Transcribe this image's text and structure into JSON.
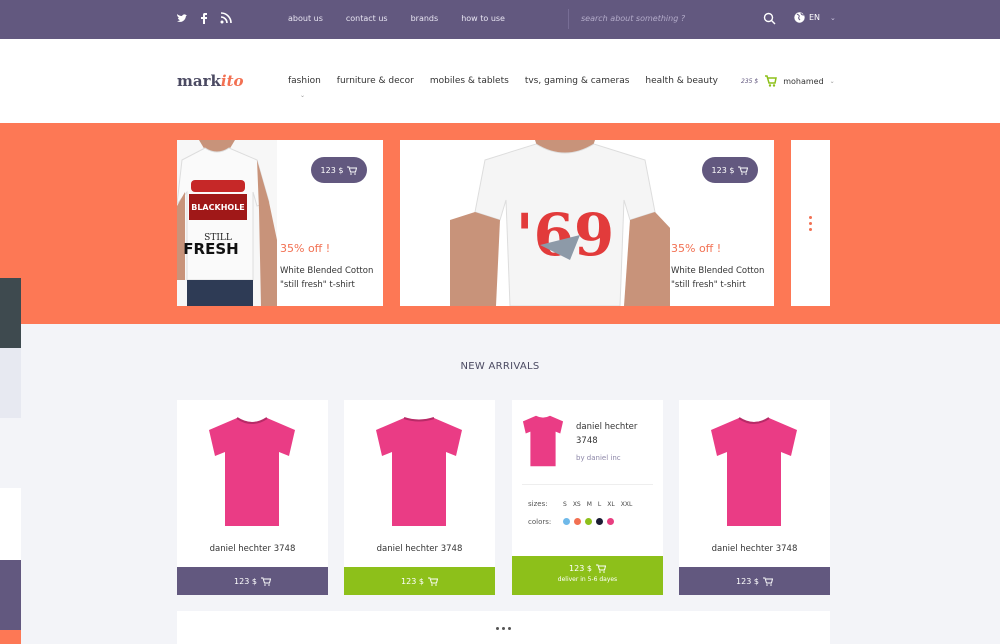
{
  "topbar": {
    "nav": [
      "about us",
      "contact us",
      "brands",
      "how to use"
    ],
    "search_placeholder": "search about something ?",
    "lang": "EN"
  },
  "header": {
    "logo_main": "mark",
    "logo_accent": "ito",
    "nav": [
      "fashion",
      "furniture & decor",
      "mobiles & tablets",
      "tvs, gaming & cameras",
      "health & beauty"
    ],
    "cart_total": "235 $",
    "user": "mohamed"
  },
  "hero": {
    "slides": [
      {
        "price": "123 $",
        "discount": "35% off !",
        "title_line1": "White Blended Cotton",
        "title_line2": "\"still fresh\" t-shirt"
      },
      {
        "price": "123 $",
        "discount": "35% off !",
        "title_line1": "White Blended Cotton",
        "title_line2": "\"still fresh\" t-shirt"
      }
    ]
  },
  "new_arrivals": {
    "title": "NEW ARRIVALS",
    "products": [
      {
        "name": "daniel hechter 3748",
        "price": "123 $"
      },
      {
        "name": "daniel hechter 3748",
        "price": "123 $"
      },
      {
        "name_line1": "daniel hechter",
        "name_line2": "3748",
        "brand": "by daniel inc",
        "sizes_label": "sizes:",
        "sizes": [
          "S",
          "XS",
          "M",
          "L",
          "XL",
          "XXL"
        ],
        "colors_label": "colors:",
        "colors": [
          "#6fb9e9",
          "#f27052",
          "#8dc01a",
          "#1b1c33",
          "#e83e80"
        ],
        "price": "123 $",
        "delivery": "deliver in 5-6 dayes"
      },
      {
        "name": "daniel hechter 3748",
        "price": "123 $"
      }
    ]
  },
  "colors": {
    "purple": "#62587f",
    "coral": "#fd7855",
    "green": "#8dc01a",
    "pink": "#e83e80"
  }
}
